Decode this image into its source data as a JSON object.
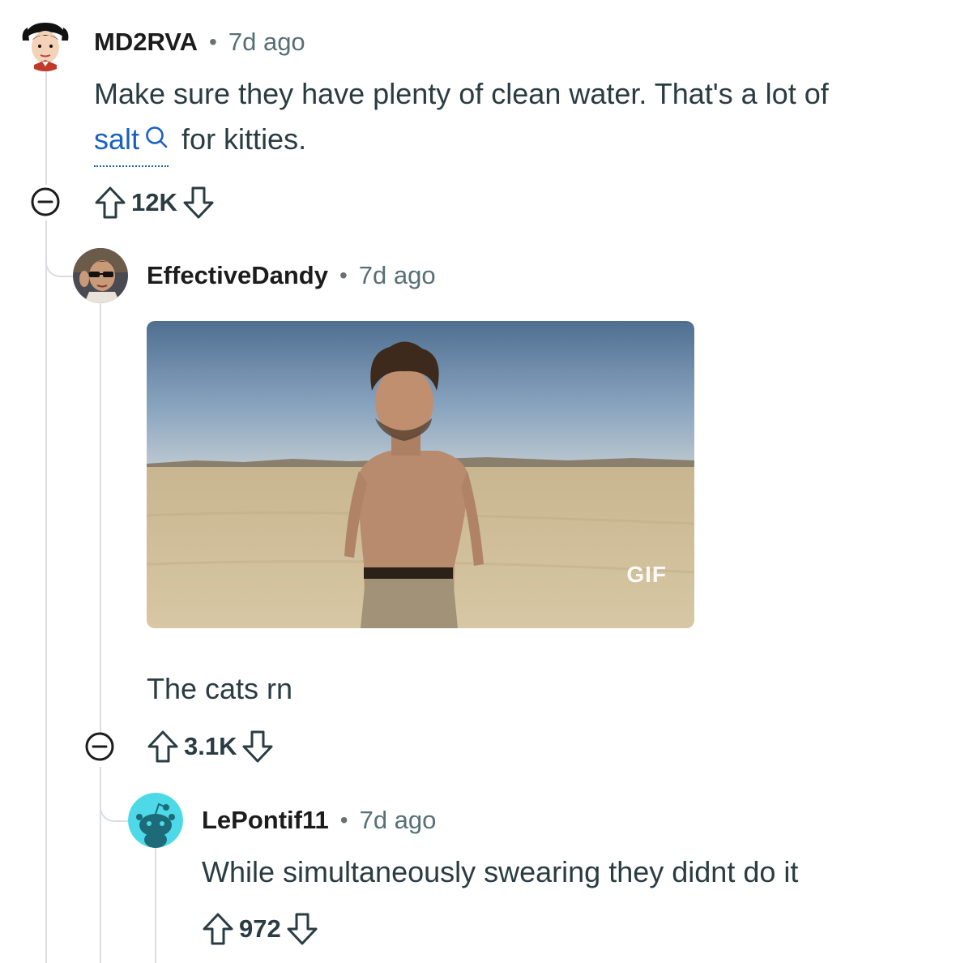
{
  "comments": [
    {
      "username": "MD2RVA",
      "separator": "•",
      "time": "7d ago",
      "text_before": "Make sure they have plenty of clean water. That's a lot of",
      "search_term": "salt",
      "text_after": "for kitties.",
      "score": "12K"
    },
    {
      "username": "EffectiveDandy",
      "separator": "•",
      "time": "7d ago",
      "gif_label": "GIF",
      "text": "The cats rn",
      "score": "3.1K"
    },
    {
      "username": "LePontif11",
      "separator": "•",
      "time": "7d ago",
      "text": "While simultaneously swearing they didnt do it",
      "score": "972"
    }
  ],
  "icons": {
    "collapse": "collapse-minus-icon",
    "upvote": "upvote-arrow-icon",
    "downvote": "downvote-arrow-icon",
    "search": "search-icon"
  },
  "colors": {
    "link": "#1a5fc2",
    "thread_line": "#dadde1",
    "muted": "#576f76",
    "avatar_teal": "#4dd9e8"
  }
}
